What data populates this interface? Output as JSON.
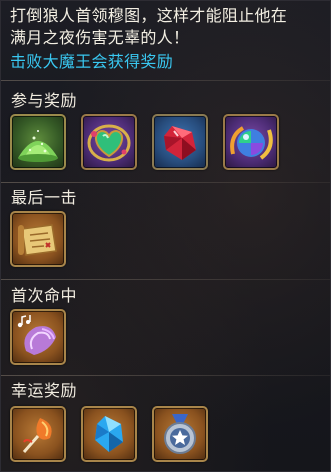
{
  "description": "打倒狼人首领穆图，这样才能阻止他在\n满月之夜伤害无辜的人！",
  "objective": "击败大魔王会获得奖励",
  "sections": [
    {
      "title": "参与奖励",
      "items": [
        {
          "icon": "green-powder-pile-icon",
          "rarity_color": "#355a26"
        },
        {
          "icon": "emerald-heart-amulet-icon",
          "rarity_color": "#4b2b73"
        },
        {
          "icon": "red-crystal-icon",
          "rarity_color": "#274c7c"
        },
        {
          "icon": "rainbow-orb-icon",
          "rarity_color": "#4b2b73"
        }
      ]
    },
    {
      "title": "最后一击",
      "items": [
        {
          "icon": "treasure-map-scroll-icon",
          "rarity_color": "#8a521f"
        }
      ]
    },
    {
      "title": "首次命中",
      "items": [
        {
          "icon": "music-conch-shell-icon",
          "rarity_color": "#8a521f"
        }
      ]
    },
    {
      "title": "幸运奖励",
      "items": [
        {
          "icon": "fire-feather-icon",
          "rarity_color": "#8a521f"
        },
        {
          "icon": "blue-crystal-icon",
          "rarity_color": "#8a521f"
        },
        {
          "icon": "silver-star-medal-icon",
          "rarity_color": "#8a521f"
        }
      ]
    }
  ]
}
